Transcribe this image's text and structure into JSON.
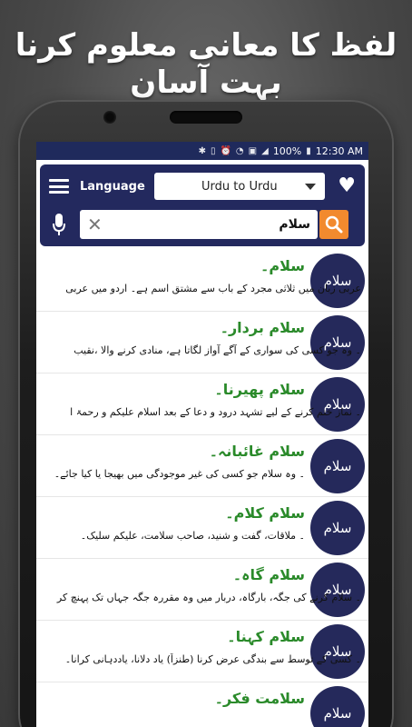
{
  "promo": {
    "title": "لفظ کا معانی معلوم کرنا بہت آسان"
  },
  "status_bar": {
    "battery": "100%",
    "time": "12:30 AM"
  },
  "toolbar": {
    "language_label": "Language",
    "language_selected": "Urdu to Urdu",
    "search_value": "سلام"
  },
  "entries": [
    {
      "thumb": "سلام",
      "word": "سلام۔",
      "meaning": "عربی زبان میں ثلاثی مجرد کے باب سے مشتق اسم ہے۔ اردو میں عربی"
    },
    {
      "thumb": "سلام",
      "word": "سلام بردار۔",
      "meaning": "۔ وہ جو کسی کی سواری کے آگے آواز لگاتا ہے، منادی کرنے والا ،نقیب"
    },
    {
      "thumb": "سلام",
      "word": "سلام پھیرنا۔",
      "meaning": "۔ نماز ختم کرنے کے لیے تشہد درود و دعا کے بعد اسلام علیکم و رحمۃ ا"
    },
    {
      "thumb": "سلام",
      "word": "سلام غائبانہ۔",
      "meaning": "۔ وہ سلام جو کسی کی غیر موجودگی میں بھیجا یا کیا جائے۔"
    },
    {
      "thumb": "سلام",
      "word": "سلام کلام۔",
      "meaning": "۔ ملاقات، گفت و شنید، صاحب سلامت، علیکم سلیک۔"
    },
    {
      "thumb": "سلام",
      "word": "سلام گاہ۔",
      "meaning": "۔ سلام کرنے کی جگہ، بارگاہ، دربار میں وہ مقررہ جگہ جہاں تک پہنچ کر"
    },
    {
      "thumb": "سلام",
      "word": "سلام کہنا۔",
      "meaning": "۔ کسی کے توسط سے بندگی عرض کرنا (طنزاً) یاد دلانا، یاددہانی کرانا۔"
    },
    {
      "thumb": "سلام",
      "word": "سلامت فکر۔",
      "meaning": ""
    }
  ],
  "colors": {
    "primary": "#23295e",
    "accent": "#f28a2e",
    "word": "#2a8a2a"
  }
}
